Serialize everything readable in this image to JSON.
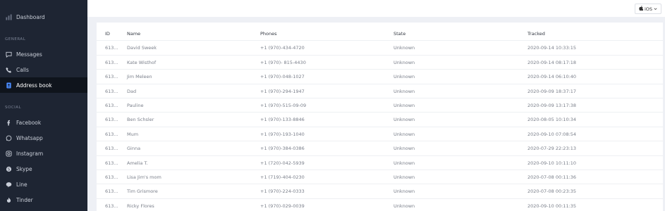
{
  "sidebar": {
    "dashboard": "Dashboard",
    "section_general": "GENERAL",
    "messages": "Messages",
    "calls": "Calls",
    "address_book": "Address book",
    "section_social": "SOCIAL",
    "facebook": "Facebook",
    "whatsapp": "Whatsapp",
    "instagram": "Instagram",
    "skype": "Skype",
    "line": "Line",
    "tinder": "Tinder"
  },
  "topbar": {
    "platform_label": "iOS"
  },
  "table": {
    "headers": {
      "id": "ID",
      "name": "Name",
      "phones": "Phones",
      "state": "State",
      "tracked": "Tracked"
    },
    "rows": [
      {
        "id": "613...",
        "name": "David Sweek",
        "phone": "+1 (970)-434-4720",
        "state": "Unknown",
        "tracked": "2020-09-14 10:33:15"
      },
      {
        "id": "613...",
        "name": "Kate Wisthof",
        "phone": "+1 (970)- 815-4430",
        "state": "Unknown",
        "tracked": "2020-09-14 08:17:18"
      },
      {
        "id": "613...",
        "name": "Jim Meleen",
        "phone": "+1 (970)-048-1027",
        "state": "Unknown",
        "tracked": "2020-09-14 06:10:40"
      },
      {
        "id": "613...",
        "name": "Dad",
        "phone": "+1 (970)-294-1947",
        "state": "Unknown",
        "tracked": "2020-09-09 18:37:17"
      },
      {
        "id": "613...",
        "name": "Pauline",
        "phone": "+1 (970)-515-09-09",
        "state": "Unknown",
        "tracked": "2020-09-09 13:17:38"
      },
      {
        "id": "613...",
        "name": "Ben Schsler",
        "phone": "+1 (970)-133-8846",
        "state": "Unknown",
        "tracked": "2020-08-05 10:10:34"
      },
      {
        "id": "613...",
        "name": "Mum",
        "phone": "+1 (970)-193-1040",
        "state": "Unknown",
        "tracked": "2020-09-10 07:08:54"
      },
      {
        "id": "613...",
        "name": "Ginna",
        "phone": "+1 (970)-384-0386",
        "state": "Unknown",
        "tracked": "2020-07-29 22:23:13"
      },
      {
        "id": "613...",
        "name": "Amelia T.",
        "phone": "+1 (720)-042-5939",
        "state": "Unknown",
        "tracked": "2020-09-10 10:11:10"
      },
      {
        "id": "613...",
        "name": "Lisa Jim's mom",
        "phone": "+1 (719)-404-0230",
        "state": "Unknown",
        "tracked": "2020-07-08 00:11:36"
      },
      {
        "id": "613...",
        "name": "Tim Grismore",
        "phone": "+1 (970)-224-0333",
        "state": "Unknown",
        "tracked": "2020-07-08 00:23:35"
      },
      {
        "id": "613...",
        "name": "Ricky Flores",
        "phone": "+1 (970)-029-0039",
        "state": "Unknown",
        "tracked": "2020-09-10 00:11:35"
      }
    ]
  },
  "colors": {
    "sidebar_bg": "#1e2533",
    "active_item_bg": "#0f141c",
    "accent": "#4a8cff"
  }
}
